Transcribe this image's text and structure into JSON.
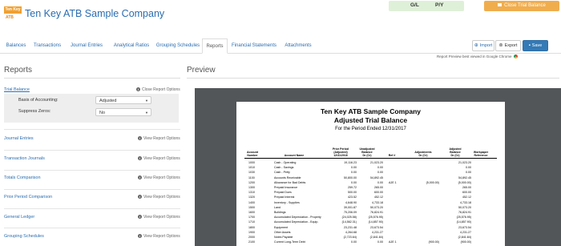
{
  "app": {
    "logo_text": "Ten Key",
    "logo_sub": "ATB",
    "title": "Ten Key ATB Sample Company",
    "gl_label": "G/L",
    "py_label": "P/Y",
    "close_label": "Close Trial Balance"
  },
  "tabs": [
    "Balances",
    "Transactions",
    "Journal Entries",
    "Analytical Ratios",
    "Grouping Schedules",
    "Reports",
    "Financial Statements",
    "Attachments"
  ],
  "toolbar": {
    "import_label": "Import",
    "export_label": "Export",
    "save_label": "Save"
  },
  "chrome_note": "Report Preview best viewed in Google Chrome",
  "left": {
    "heading": "Reports",
    "trial_balance": "Trial Balance",
    "close_options": "Close Report Options",
    "view_options": "View Report Options",
    "basis_label": "Basis of Accounting:",
    "basis_value": "Adjusted",
    "suppress_label": "Suppress Zeros:",
    "suppress_value": "No",
    "reports": [
      "Journal Entries",
      "Transaction Journals",
      "Totals Comparison",
      "Prior Period Comparison",
      "General Ledger",
      "Grouping Schedules"
    ]
  },
  "preview": {
    "heading": "Preview",
    "company": "Ten Key ATB Sample Company",
    "report_title": "Adjusted Trial Balance",
    "period": "For the Period Ended 12/31/2017",
    "columns": [
      [
        "Account",
        "Number"
      ],
      [
        "Account Name"
      ],
      [
        "Prior Period",
        "(Adjusted)",
        "12/31/2016"
      ],
      [
        "Unadjusted",
        "Balance",
        "Dr (Cr)"
      ],
      [
        "Ref #"
      ],
      [
        "Adjustments",
        "Dr (Cr)"
      ],
      [
        "Adjusted",
        "Balance",
        "Dr (Cr)"
      ],
      [
        "Workpaper",
        "Reference"
      ]
    ],
    "rows": [
      [
        "1000",
        "Cash - Operating",
        "19,116.23",
        "21,023.20",
        "",
        "",
        "21,023.20"
      ],
      [
        "1010",
        "Cash - Savings",
        "0.00",
        "0.00",
        "",
        "",
        "0.00"
      ],
      [
        "1030",
        "Cash - Petty",
        "0.00",
        "0.00",
        "",
        "",
        "0.00"
      ],
      [
        "1100",
        "Accounts Receivable",
        "50,800.00",
        "54,892.45",
        "",
        "",
        "54,892.45"
      ],
      [
        "1200",
        "Allowance for Bad Debts",
        "0.00",
        "0.00",
        "AJE 1",
        "(5,000.00)",
        "(5,000.00)"
      ],
      [
        "1300",
        "Prepaid Insurance",
        "259.72",
        "265.00",
        "",
        "",
        "265.00"
      ],
      [
        "1310",
        "Prepaid Dues",
        "500.00",
        "600.00",
        "",
        "",
        "600.00"
      ],
      [
        "1320",
        "Prepaid Interest",
        "423.52",
        "452.12",
        "",
        "",
        "452.12"
      ],
      [
        "1400",
        "Inventory - Supplies",
        "4,648.90",
        "4,733.18",
        "",
        "",
        "4,733.18"
      ],
      [
        "1500",
        "Land",
        "39,001.87",
        "50,073.20",
        "",
        "",
        "50,073.20"
      ],
      [
        "1600",
        "Buildings",
        "75,206.09",
        "76,824.91",
        "",
        "",
        "76,824.91"
      ],
      [
        "1700",
        "Accumulated Depreciation - Property",
        "(24,025.58)",
        "(25,576.95)",
        "",
        "",
        "(25,576.95)"
      ],
      [
        "1710",
        "Accumulated Depreciation - Equip.",
        "(14,562.31)",
        "(14,857.90)",
        "",
        "",
        "(14,857.90)"
      ],
      [
        "1800",
        "Equipment",
        "23,231.48",
        "23,673.54",
        "",
        "",
        "23,673.54"
      ],
      [
        "1900",
        "Other Assets",
        "4,264.68",
        "4,231.27",
        "",
        "",
        "4,231.27"
      ],
      [
        "2000",
        "Notes Payable",
        "(2,723.64)",
        "(2,841.84)",
        "",
        "",
        "(2,841.84)"
      ],
      [
        "2100",
        "Current Long-Term Debt",
        "0.00",
        "0.00",
        "AJE 1",
        "(900.00)",
        "(900.00)"
      ]
    ]
  }
}
